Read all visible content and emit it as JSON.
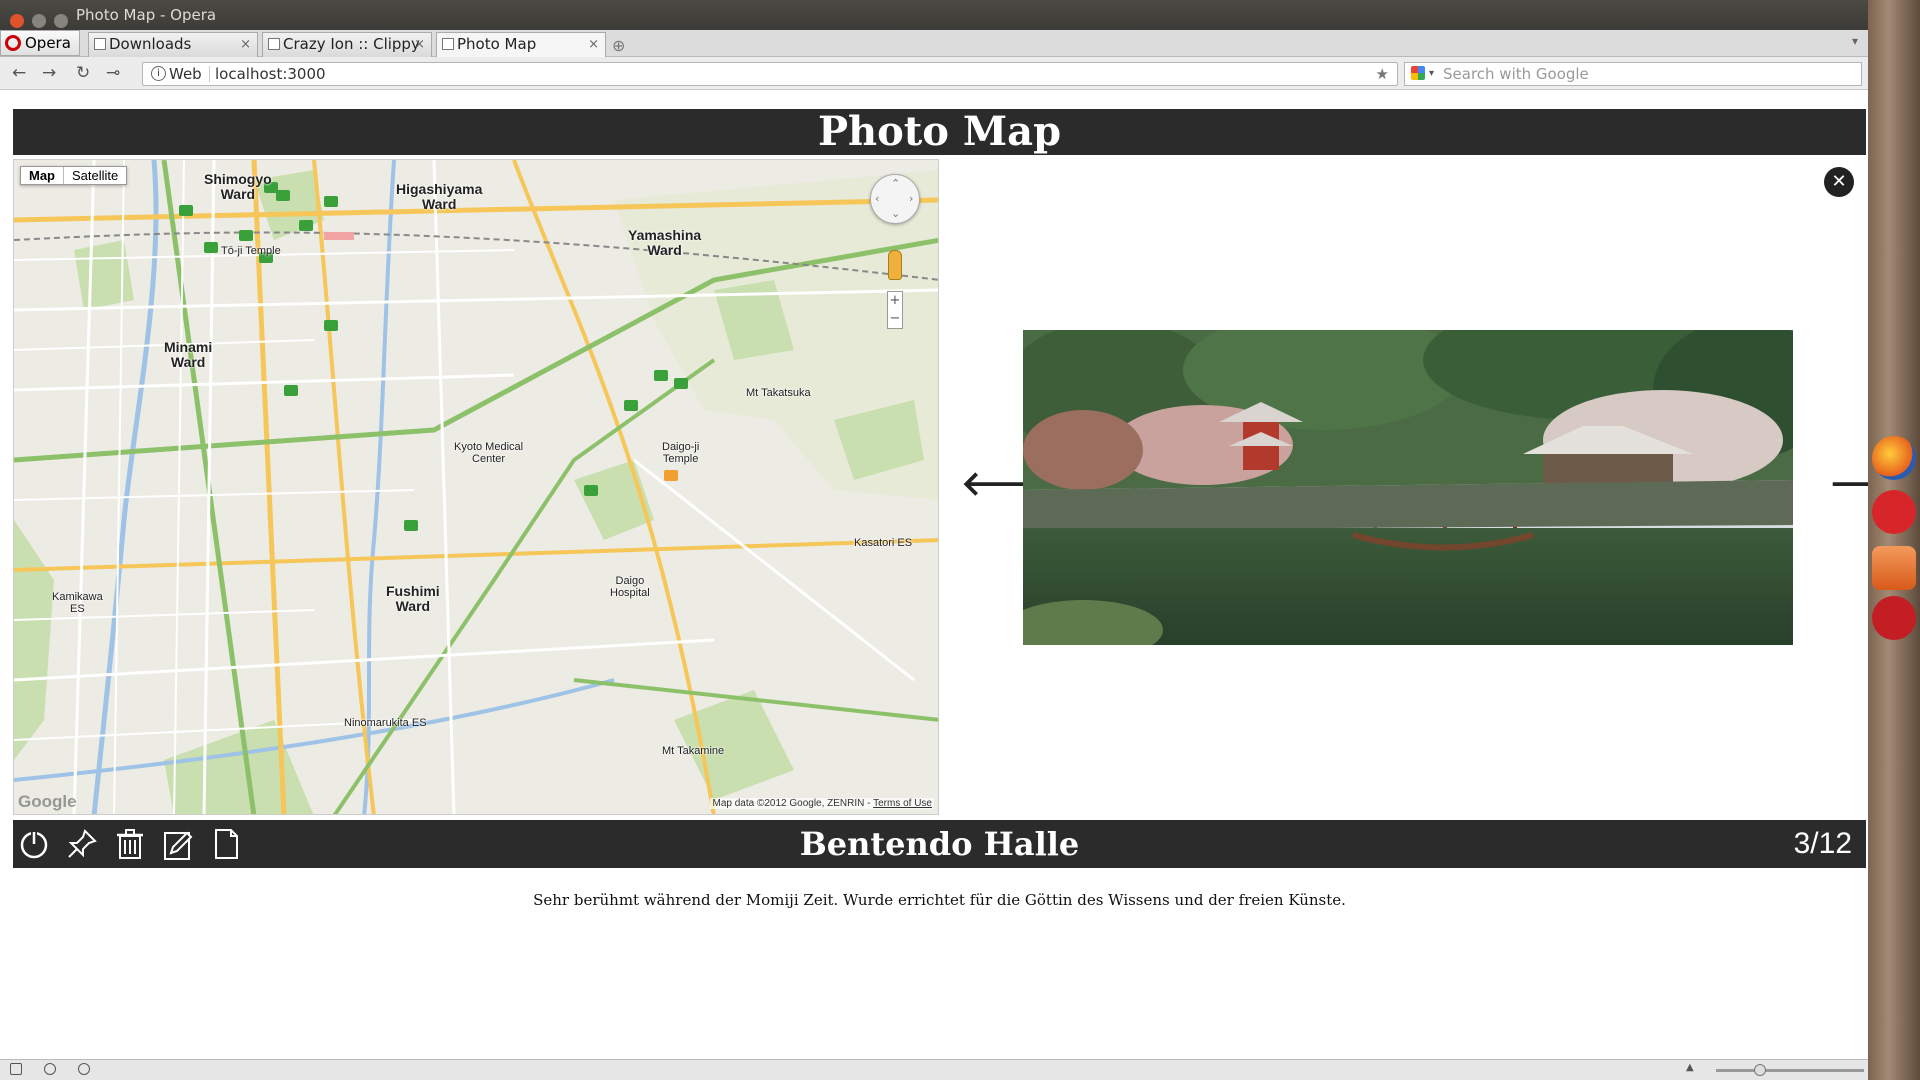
{
  "window": {
    "title": "Photo Map - Opera"
  },
  "tabs": {
    "opera_label": "Opera",
    "items": [
      {
        "label": "Downloads"
      },
      {
        "label": "Crazy Ion :: Clippy"
      },
      {
        "label": "Photo Map"
      }
    ]
  },
  "navbar": {
    "web_label": "Web",
    "url": "localhost:3000",
    "search_placeholder": "Search with Google"
  },
  "app": {
    "header_title": "Photo Map"
  },
  "map": {
    "type_map": "Map",
    "type_satellite": "Satellite",
    "logo": "Google",
    "attribution": "Map data ©2012 Google, ZENRIN - ",
    "terms": "Terms of Use",
    "labels": {
      "shimogyo": "Shimogyo\nWard",
      "higashiyama": "Higashiyama\nWard",
      "yamashina": "Yamashina\nWard",
      "minami": "Minami\nWard",
      "fushimi": "Fushimi\nWard",
      "takatsuka": "Mt Takatsuka",
      "takamine": "Mt Takamine",
      "daigo_temple": "Daigo-ji\nTemple",
      "kyoto_medical": "Kyoto Medical\nCenter",
      "toji": "Tō-ji Temple",
      "daigo_hospital": "Daigo\nHospital",
      "kamikawa": "Kamikawa\nES",
      "kasatori": "Kasatori ES",
      "ninomaruita": "Ninomarukita ES"
    }
  },
  "viewer": {
    "prev_icon": "left-arrow-icon",
    "next_icon": "right-arrow-icon",
    "close_icon": "close-icon"
  },
  "footer": {
    "title": "Bentendo Halle",
    "counter": "3/12",
    "tools": [
      "power-icon",
      "pin-icon",
      "trash-icon",
      "edit-icon",
      "new-document-icon"
    ]
  },
  "description": "Sehr berühmt während der Momiji Zeit. Wurde errichtet für die Göttin des Wissens und der freien Künste.",
  "colors": {
    "header_bg": "#2b2b2b",
    "map_water": "#9fc2e7",
    "map_park": "#c9dfaf",
    "road_major": "#f6c659"
  }
}
